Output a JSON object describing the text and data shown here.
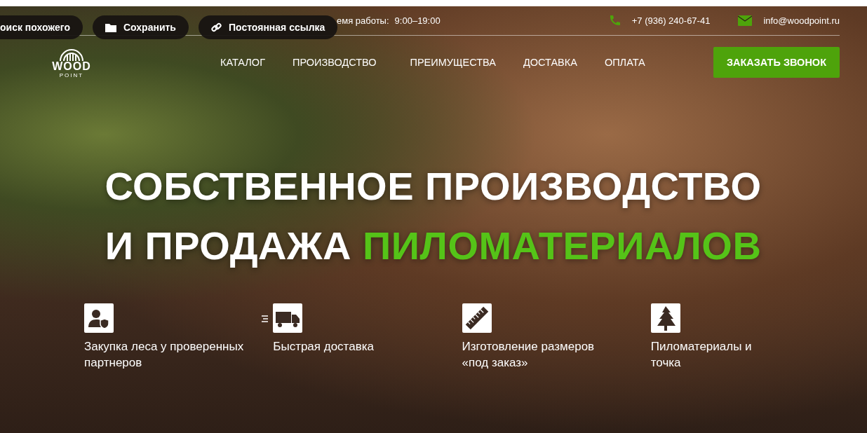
{
  "overlay_buttons": [
    {
      "kind": "search",
      "label": "оиск похожего"
    },
    {
      "kind": "folder",
      "label": "Сохранить"
    },
    {
      "kind": "link",
      "label": "Постоянная ссылка"
    }
  ],
  "top_bar": {
    "hours_label": "емя работы:",
    "hours": "9:00–19:00",
    "phone": "+7 (936) 240-67-41",
    "email": "info@woodpoint.ru"
  },
  "logo": {
    "word": "WOOD",
    "sub": "POINT"
  },
  "nav": [
    "КАТАЛОГ",
    "ПРОИЗВОДСТВО",
    "ПРЕИМУЩЕСТВА",
    "ДОСТАВКА",
    "ОПЛАТА"
  ],
  "cta_button": "ЗАКАЗАТЬ ЗВОНОК",
  "headline": {
    "line_1": "СОБСТВЕННОЕ ПРОИЗВОДСТВО",
    "line_2": "И ПРОДАЖА",
    "highlight": "ПИЛОМАТЕРИАЛОВ"
  },
  "features": [
    {
      "kind": "partner",
      "text": "Закупка леса у проверенных партнеров"
    },
    {
      "kind": "truck",
      "text": "Быстрая доставка"
    },
    {
      "kind": "ruler",
      "text": "Изготовление размеров «под заказ»"
    },
    {
      "kind": "tree",
      "text": "Пиломатериалы и точка"
    }
  ]
}
